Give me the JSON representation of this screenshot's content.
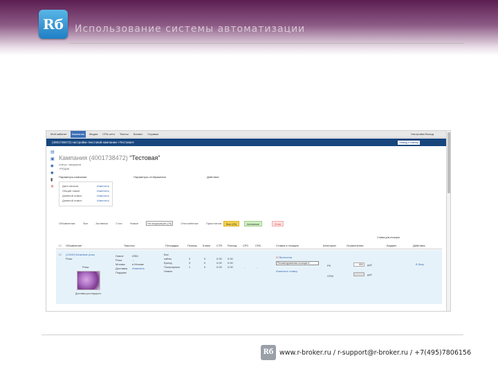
{
  "slide": {
    "logo_text": "Rб",
    "title": "Использование системы автоматизации",
    "footer_logo_text": "Rб",
    "footer_text": "www.r-broker.ru / r-support@r-broker.ru / +7(495)7806156"
  },
  "app": {
    "menu": [
      "Мой кабинет",
      "Кампании",
      "Медиа",
      "СРА-сети",
      "Тексты",
      "Баланс",
      "Справка"
    ],
    "active_menu_index": 1,
    "user_text": "Настройки  Выход",
    "nav_title": "(4001738472) настройки текстовой кампании «Тестовая»",
    "back_button": "Назад к списку",
    "campaign_id": "Кампания (4001738472)",
    "campaign_name": "“Тестовая”",
    "campaign_status": "статус: запущена",
    "campaign_link": "+РЕДАК",
    "tool_icons": [
      "doc-icon",
      "save-icon",
      "diamond-icon",
      "diamond-icon",
      "trash-icon",
      "close-icon"
    ],
    "sections": {
      "params": "Параметры кампании",
      "display": "Параметры отображения",
      "actions": "Действия"
    },
    "params_rows": [
      {
        "label": "Дата начала",
        "link": "Изменить"
      },
      {
        "label": "Общий лимит",
        "link": "Изменить"
      },
      {
        "label": "Дневной лимит",
        "link": "Изменить"
      },
      {
        "label": "Дневной лимит",
        "link": "Изменить"
      }
    ],
    "filters": [
      "Объявления:",
      "Все",
      "Активные",
      "Стоп",
      "Новые",
      "На модерации (25)",
      "Отклонённые",
      "Приостанов."
    ],
    "buttons": {
      "yellow": "Все (25)",
      "green": "Активные",
      "red": "Стоп"
    },
    "extra_head": "Ставка для позиции",
    "table_headers": [
      "Объявление",
      "Таксоны",
      "Площадки",
      "Показы",
      "Клики",
      "CTR",
      "Расход",
      "CPC",
      "CPA",
      "Ставка и позиция",
      "Категории",
      "Ограничения",
      "Бюджет",
      "Действия"
    ],
    "row": {
      "ad_title": "(13040) Бежевые розы",
      "ad_sub": "Розы",
      "photo_caption": "Доставка роз недорого",
      "taxons": [
        "Новое",
        "Розы",
        "Москва",
        "Доставка",
        "Подарки"
      ],
      "taxon_vals": [
        "ИЗМ",
        "...",
        "в Москве",
        "",
        "Изменить"
      ],
      "platforms": [
        "Все",
        "сайты",
        "Бренд",
        "Популярные",
        "Новые"
      ],
      "shows": [
        "3",
        "3",
        "1"
      ],
      "clicks": [
        "0",
        "0",
        "0"
      ],
      "ctr": [
        "0.00",
        "0.00",
        "0.00"
      ],
      "spend": [
        "0.00",
        "0.00",
        "0.00"
      ],
      "cpc": "-",
      "cpa": "-",
      "status_link": "Включена",
      "select_value": "Рекомендованная позиция",
      "link_below": "Изменить ставку",
      "category_1": "РК",
      "category_2": "CPM",
      "limit_1": "850",
      "limit_unit_1": "руб",
      "limit_unit_2": "руб",
      "action": "В базу"
    }
  }
}
